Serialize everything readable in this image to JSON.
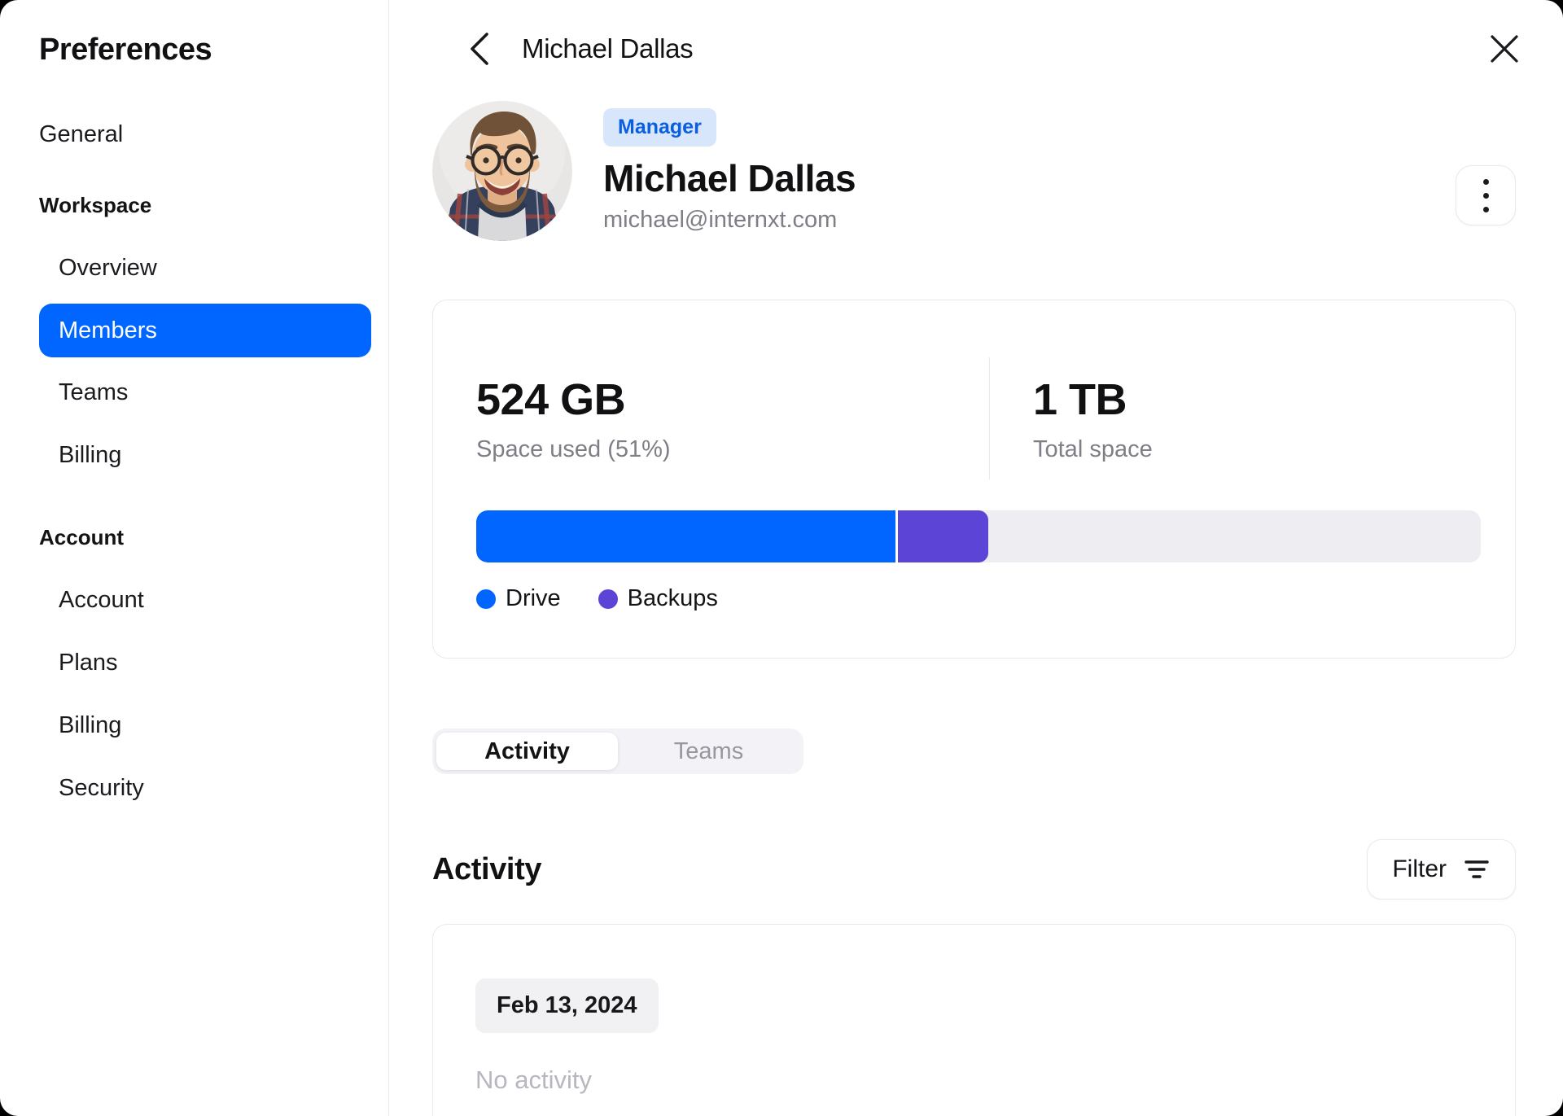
{
  "colors": {
    "accent": "#0066FF",
    "backups": "#5C45D6",
    "badge_bg": "#D8E6FC",
    "badge_text": "#0A5FE0",
    "track": "#EDEDF2",
    "border": "#E9E9EE",
    "text_primary": "#18181B",
    "text_secondary": "#7E7E86",
    "text_tertiary": "#B7B7BF"
  },
  "sidebar": {
    "title": "Preferences",
    "items": [
      {
        "label": "General"
      },
      {
        "label": "Workspace"
      },
      {
        "label": "Overview"
      },
      {
        "label": "Members"
      },
      {
        "label": "Teams"
      },
      {
        "label": "Billing"
      },
      {
        "label": "Account"
      },
      {
        "label": "Account"
      },
      {
        "label": "Plans"
      },
      {
        "label": "Billing"
      },
      {
        "label": "Security"
      }
    ]
  },
  "header": {
    "title": "Michael Dallas"
  },
  "profile": {
    "badge": "Manager",
    "name": "Michael Dallas",
    "email": "michael@internxt.com"
  },
  "usage": {
    "used_value": "524 GB",
    "used_label": "Space used (51%)",
    "total_value": "1 TB",
    "total_label": "Total space",
    "bar": {
      "drive_pct": 42,
      "backups_pct": 9
    },
    "legend": [
      {
        "label": "Drive",
        "color": "#0066FF"
      },
      {
        "label": "Backups",
        "color": "#5C45D6"
      }
    ]
  },
  "tabs": [
    {
      "label": "Activity"
    },
    {
      "label": "Teams"
    }
  ],
  "activity": {
    "heading": "Activity",
    "filter_label": "Filter",
    "date_chip": "Feb 13, 2024",
    "empty_text": "No activity"
  }
}
